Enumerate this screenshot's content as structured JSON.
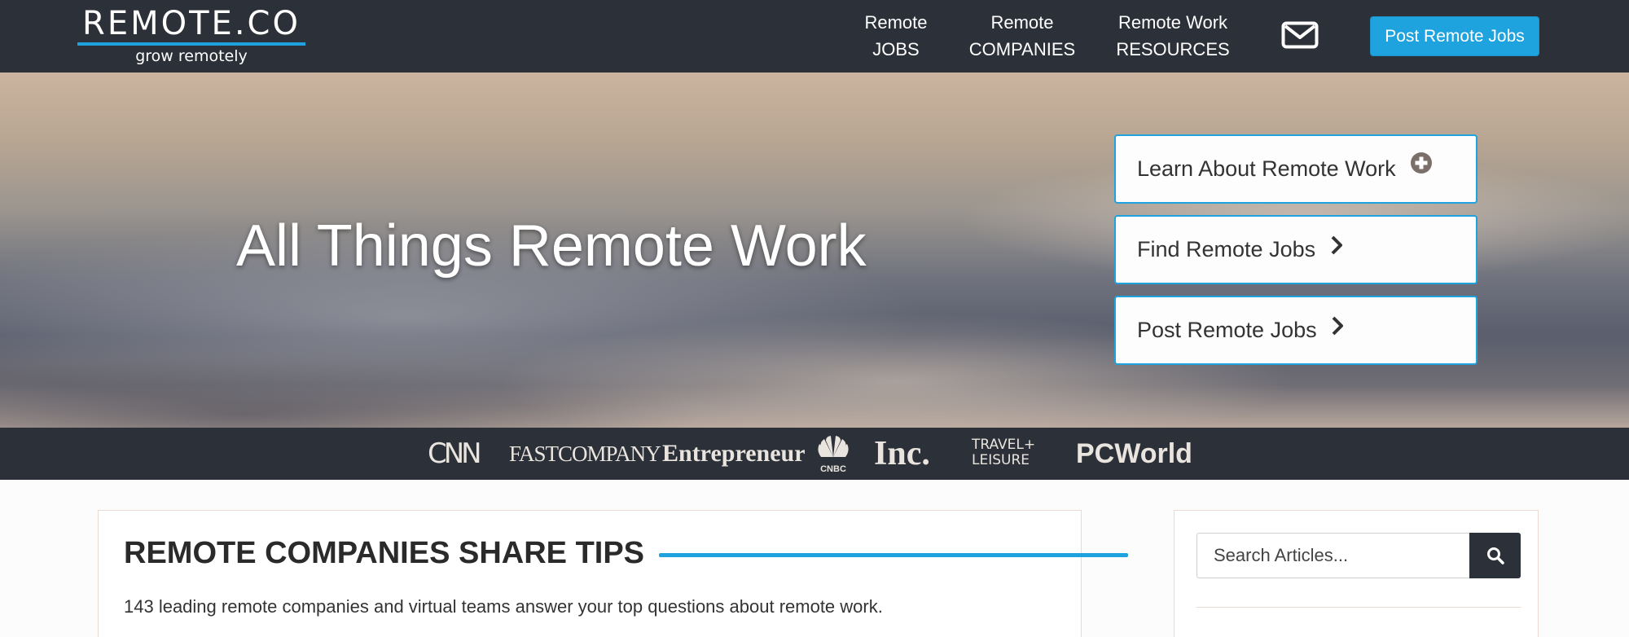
{
  "header": {
    "logo_main": "REMOTE.CO",
    "logo_tagline": "grow remotely",
    "nav": [
      {
        "line1": "Remote",
        "line2": "JOBS"
      },
      {
        "line1": "Remote",
        "line2": "COMPANIES"
      },
      {
        "line1": "Remote Work",
        "line2": "RESOURCES"
      }
    ],
    "mail_icon": "envelope-icon",
    "post_button": "Post Remote Jobs"
  },
  "hero": {
    "title": "All Things Remote Work",
    "buttons": [
      {
        "label": "Learn About Remote Work",
        "icon": "plus-circle-icon"
      },
      {
        "label": "Find Remote Jobs",
        "icon": "chevron-right-icon"
      },
      {
        "label": "Post Remote Jobs",
        "icon": "chevron-right-icon"
      }
    ]
  },
  "press": {
    "logos": [
      "CNN",
      "FASTCOMPANY",
      "Entrepreneur",
      "CNBC",
      "Inc.",
      "TRAVEL+",
      "LEISURE",
      "PCWorld"
    ]
  },
  "main": {
    "title": "REMOTE COMPANIES SHARE TIPS",
    "description": "143 leading remote companies and virtual teams answer your top questions about remote work."
  },
  "sidebar": {
    "search_placeholder": "Search Articles...",
    "search_icon": "search-icon"
  },
  "colors": {
    "header_bg": "#2c3038",
    "accent": "#1ea3df"
  }
}
